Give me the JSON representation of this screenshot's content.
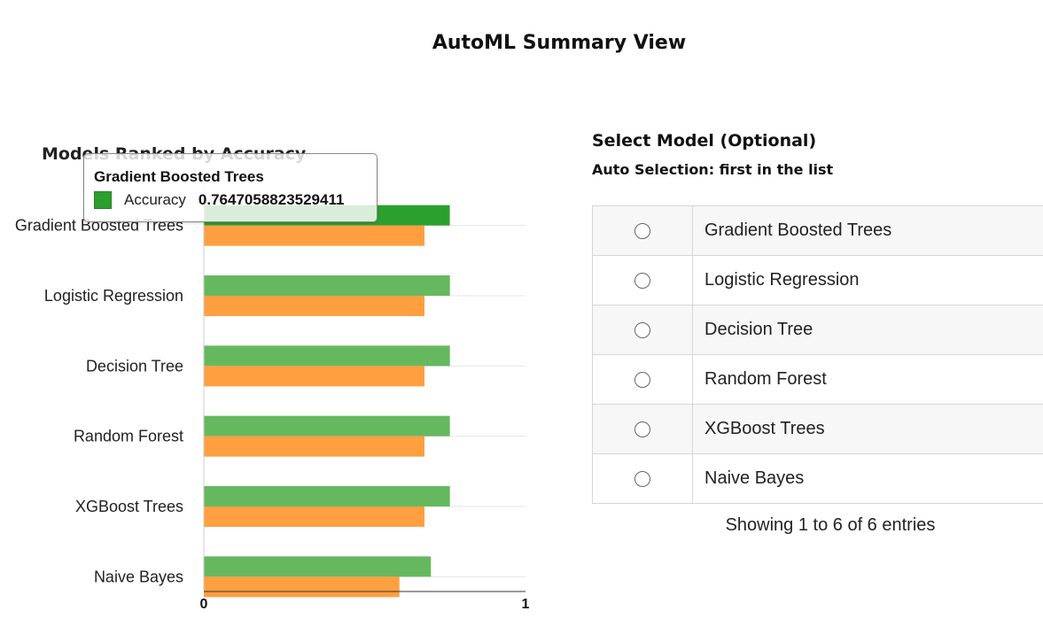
{
  "page": {
    "title": "AutoML Summary View"
  },
  "chart_data": {
    "type": "bar",
    "orientation": "horizontal",
    "title": "Models Ranked by Accuracy",
    "categories": [
      "Gradient Boosted Trees",
      "Logistic Regression",
      "Decision Tree",
      "Random Forest",
      "XGBoost Trees",
      "Naive Bayes"
    ],
    "series": [
      {
        "name": "Accuracy",
        "color": "#66b85e",
        "values": [
          0.7647058823529411,
          0.765,
          0.765,
          0.765,
          0.765,
          0.706
        ]
      },
      {
        "color": "#ff9f40",
        "values": [
          0.686,
          0.686,
          0.686,
          0.686,
          0.686,
          0.608
        ]
      }
    ],
    "xlim": [
      0,
      1
    ],
    "xticks": [
      "0",
      "1"
    ],
    "highlight_color": "#2ca02c",
    "grid": true
  },
  "tooltip": {
    "title": "Gradient Boosted Trees",
    "series_name": "Accuracy",
    "value": "0.7647058823529411",
    "swatch_color": "#2ca02c"
  },
  "selector": {
    "title": "Select Model (Optional)",
    "subtitle": "Auto Selection: first in the list",
    "rows": [
      {
        "name": "Gradient Boosted Trees"
      },
      {
        "name": "Logistic Regression"
      },
      {
        "name": "Decision Tree"
      },
      {
        "name": "Random Forest"
      },
      {
        "name": "XGBoost Trees"
      },
      {
        "name": "Naive Bayes"
      }
    ],
    "info": "Showing 1 to 6 of 6 entries"
  }
}
